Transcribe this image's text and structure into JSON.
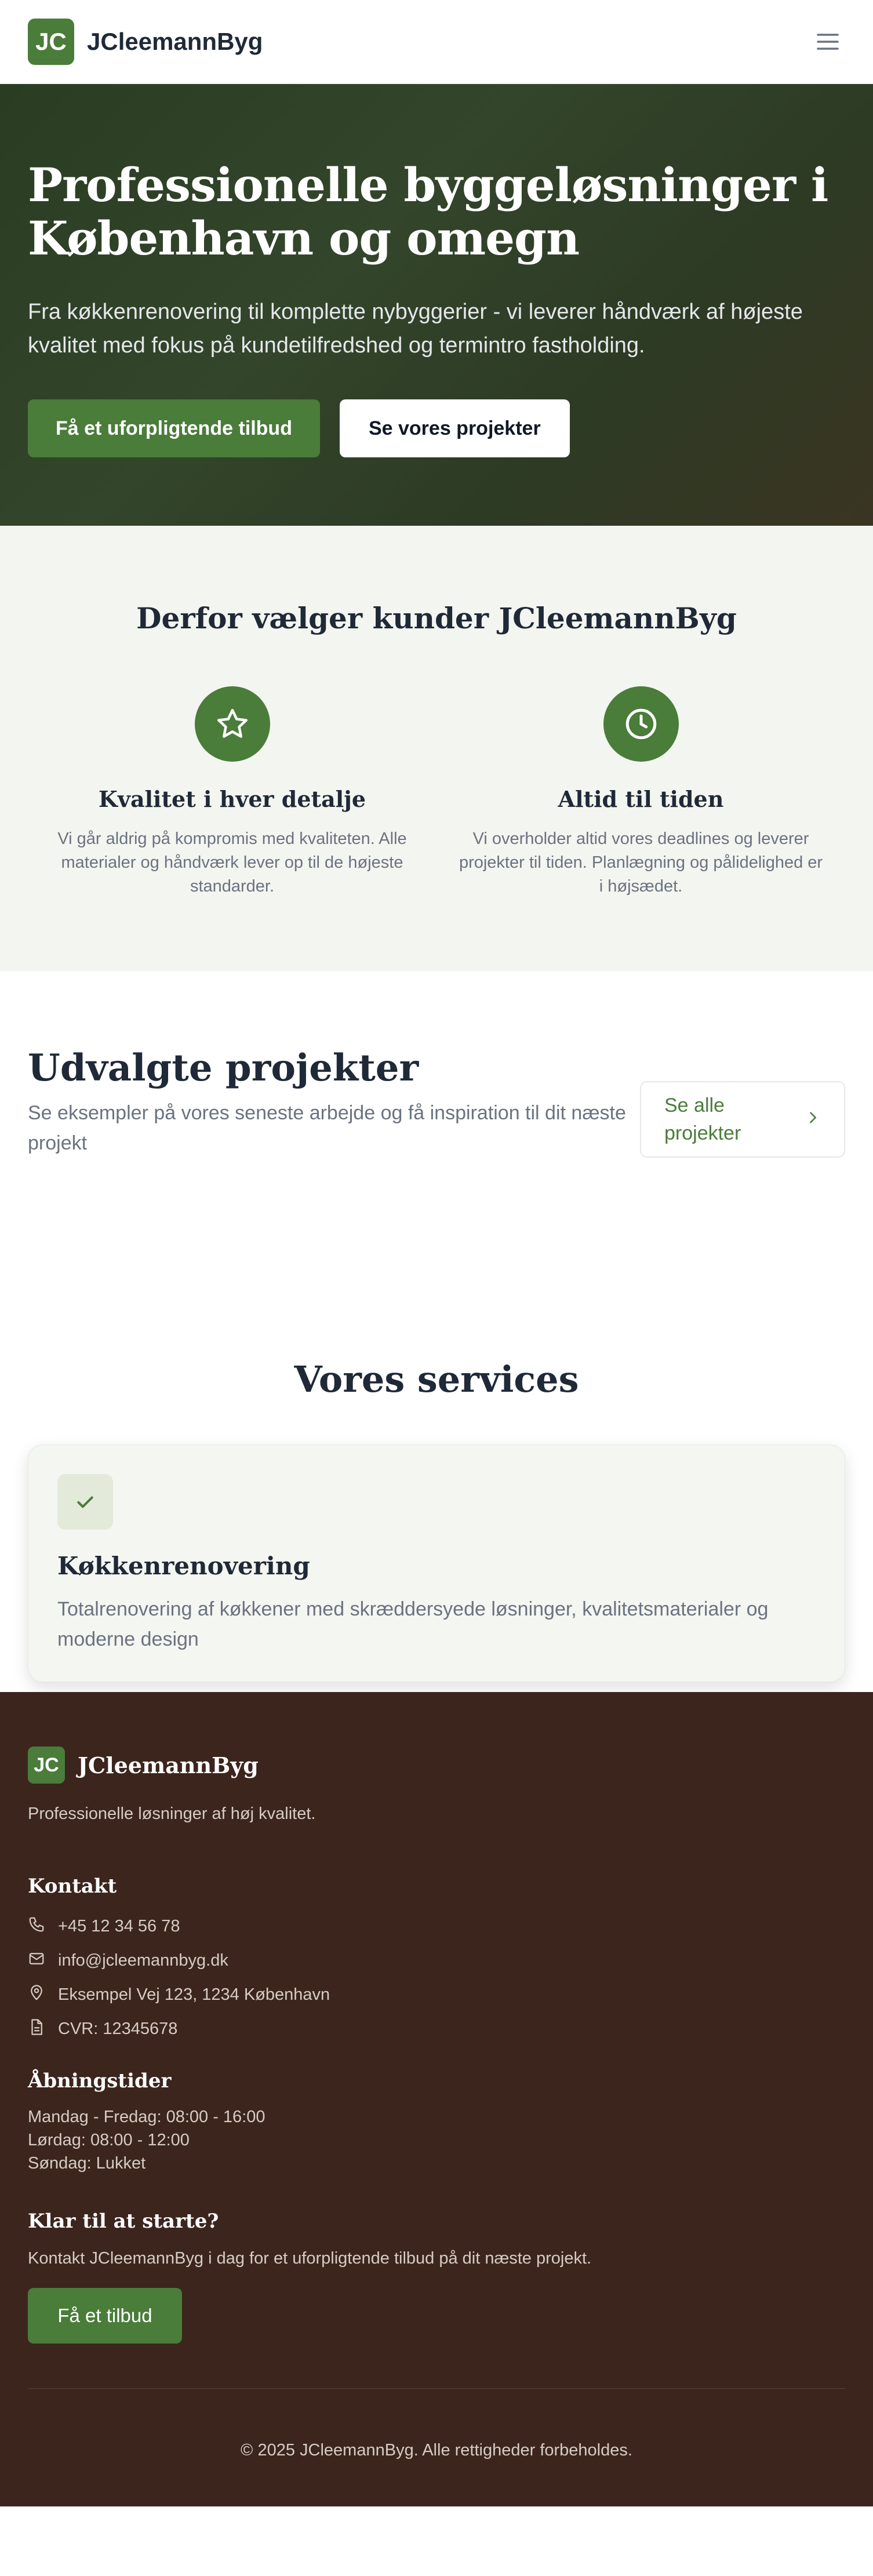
{
  "header": {
    "logo_initials": "JC",
    "brand_name": "JCleemannByg",
    "menu_icon": "hamburger-menu-icon"
  },
  "hero": {
    "title": "Professionelle byggeløsninger i København og omegn",
    "subtitle": "Fra køkkenrenovering til komplette nybyggerier - vi leverer håndværk af højeste kvalitet med fokus på kundetilfredshed og termintro fastholding.",
    "primary_cta": "Få et uforpligtende tilbud",
    "secondary_cta": "Se vores projekter"
  },
  "why": {
    "title": "Derfor vælger kunder JCleemannByg",
    "features": [
      {
        "icon": "star-icon",
        "title": "Kvalitet i hver detalje",
        "description": "Vi går aldrig på kompromis med kvaliteten. Alle materialer og håndværk lever op til de højeste standarder."
      },
      {
        "icon": "clock-icon",
        "title": "Altid til tiden",
        "description": "Vi overholder altid vores deadlines og leverer projekter til tiden. Planlægning og pålidelighed er i højsædet."
      }
    ]
  },
  "projects": {
    "title": "Udvalgte projekter",
    "subtitle": "Se eksempler på vores seneste arbejde og få inspiration til dit næste projekt",
    "see_all": "Se alle projekter"
  },
  "services": {
    "title": "Vores services",
    "items": [
      {
        "icon": "check-icon",
        "title": "Køkkenrenovering",
        "description": "Totalrenovering af køkkener med skræddersyede løsninger, kvalitetsmaterialer og moderne design"
      }
    ]
  },
  "footer": {
    "logo_initials": "JC",
    "brand_name": "JCleemannByg",
    "tagline": "Professionelle løsninger af høj kvalitet.",
    "contact_heading": "Kontakt",
    "contact": {
      "phone": "+45 12 34 56 78",
      "email": "info@jcleemannbyg.dk",
      "address": "Eksempel Vej 123, 1234 København",
      "cvr": "CVR: 12345678"
    },
    "hours_heading": "Åbningstider",
    "hours": [
      "Mandag - Fredag: 08:00 - 16:00",
      "Lørdag: 08:00 - 12:00",
      "Søndag: Lukket"
    ],
    "cta_heading": "Klar til at starte?",
    "cta_text": "Kontakt JCleemannByg i dag for et uforpligtende tilbud på dit næste projekt.",
    "cta_button": "Få et tilbud",
    "copyright": "© 2025 JCleemannByg. Alle rettigheder forbeholdes."
  },
  "colors": {
    "accent": "#4a7c3a",
    "hero_bg": "#2f4127",
    "section_bg": "#f3f5f0",
    "footer_bg": "#3c251d"
  }
}
